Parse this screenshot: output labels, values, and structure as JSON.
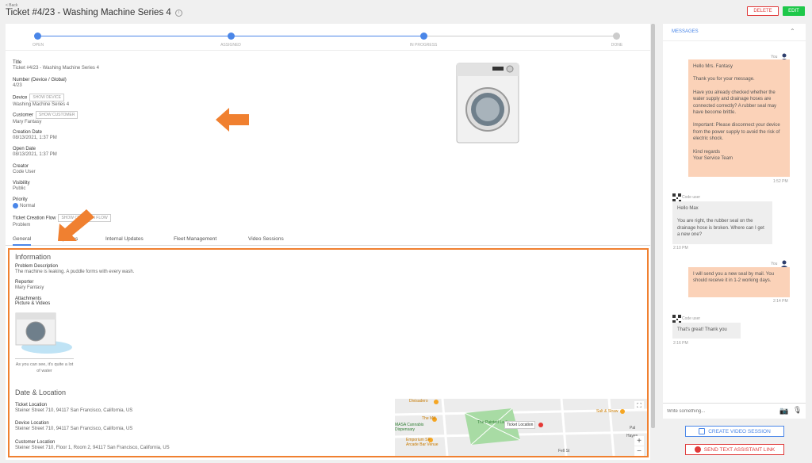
{
  "header": {
    "back": "< Back",
    "title": "Ticket #4/23 - Washing Machine Series 4",
    "delete": "DELETE",
    "edit": "EDIT"
  },
  "steps": [
    {
      "label": "OPEN",
      "active": true
    },
    {
      "label": "ASSIGNED",
      "active": true
    },
    {
      "label": "IN PROGRESS",
      "active": true
    },
    {
      "label": "DONE",
      "active": false
    }
  ],
  "fields": {
    "title_label": "Title",
    "title_value": "Ticket #4/23 - Washing Machine Series 4",
    "number_label": "Number (Device / Global)",
    "number_value": "4/23",
    "device_label": "Device",
    "device_btn": "SHOW DEVICE",
    "device_value": "Washing Machine Series 4",
    "customer_label": "Customer",
    "customer_btn": "SHOW CUSTOMER",
    "customer_value": "Mary Fantasy",
    "creation_label": "Creation Date",
    "creation_value": "08/13/2021, 1:37 PM",
    "open_label": "Open Date",
    "open_value": "08/13/2021, 1:37 PM",
    "creator_label": "Creator",
    "creator_value": "Code User",
    "visibility_label": "Visibility",
    "visibility_value": "Public",
    "priority_label": "Priority",
    "priority_value": "Normal",
    "flow_label": "Ticket Creation Flow",
    "flow_btn": "SHOW CREATION FLOW",
    "flow_value": "Problem"
  },
  "tabs": [
    "General",
    "Updates",
    "Internal Updates",
    "Fleet Management",
    "Video Sessions"
  ],
  "info": {
    "heading": "Information",
    "problem_label": "Problem Description",
    "problem_value": "The machine is leaking. A puddle forms with every wash.",
    "reporter_label": "Reporter",
    "reporter_value": "Mary Fantasy",
    "attach_label": "Attachments",
    "attach_sub": "Picture & Videos",
    "caption": "As you can see, it's quite a lot of water"
  },
  "location": {
    "heading": "Date & Location",
    "ticket_label": "Ticket Location",
    "ticket_value": "Steiner Street 710, 94117 San Francisco, California, US",
    "device_label": "Device Location",
    "device_value": "Steiner Street 710, 94117 San Francisco, California, US",
    "customer_label": "Customer Location",
    "customer_value": "Steiner Street 710, Floor 1, Room 2, 94117 San Francisco, California, US"
  },
  "map": {
    "labels": [
      "Divisadero",
      "The Mill",
      "The Painted Ladies",
      "Ticket Location",
      "Salt & Straw",
      "Emporium SF Arcade Bar Venue",
      "MASA Cannabis Dispensary",
      "Fell St",
      "Pal",
      "Hayes"
    ]
  },
  "messages": {
    "heading": "MESSAGES",
    "you": "You",
    "code_user": "Code user",
    "m1": [
      "Hello Mrs. Fantasy",
      "",
      "Thank you for your message.",
      "",
      "Have you already checked whether the water supply and drainage hoses are connected correctly? A rubber seal may have become brittle.",
      "",
      "Important: Please disconnect your device from the power supply to avoid the risk of electric shock.",
      "",
      "Kind regards",
      "Your Service Team"
    ],
    "t1": "1:52 PM",
    "m2": [
      "Hello Max",
      "",
      "You are right, the rubber seal on the drainage hose is broken. Where can I get a new one?"
    ],
    "t2": "2:10 PM",
    "m3": [
      "I will send you a new seal by mail. You should receive it in 1-2 working days."
    ],
    "t3": "2:14 PM",
    "m4": [
      "That's great! Thank you"
    ],
    "t4": "2:16 PM",
    "placeholder": "Write something...",
    "video_btn": "CREATE VIDEO SESSION",
    "assistant_btn": "SEND TEXT ASSISTANT LINK"
  },
  "colors": {
    "accent": "#4a86e8",
    "highlight": "#f08030",
    "danger": "#e03a3a",
    "success": "#1ec84a",
    "you_bubble": "#fbd2b8"
  }
}
